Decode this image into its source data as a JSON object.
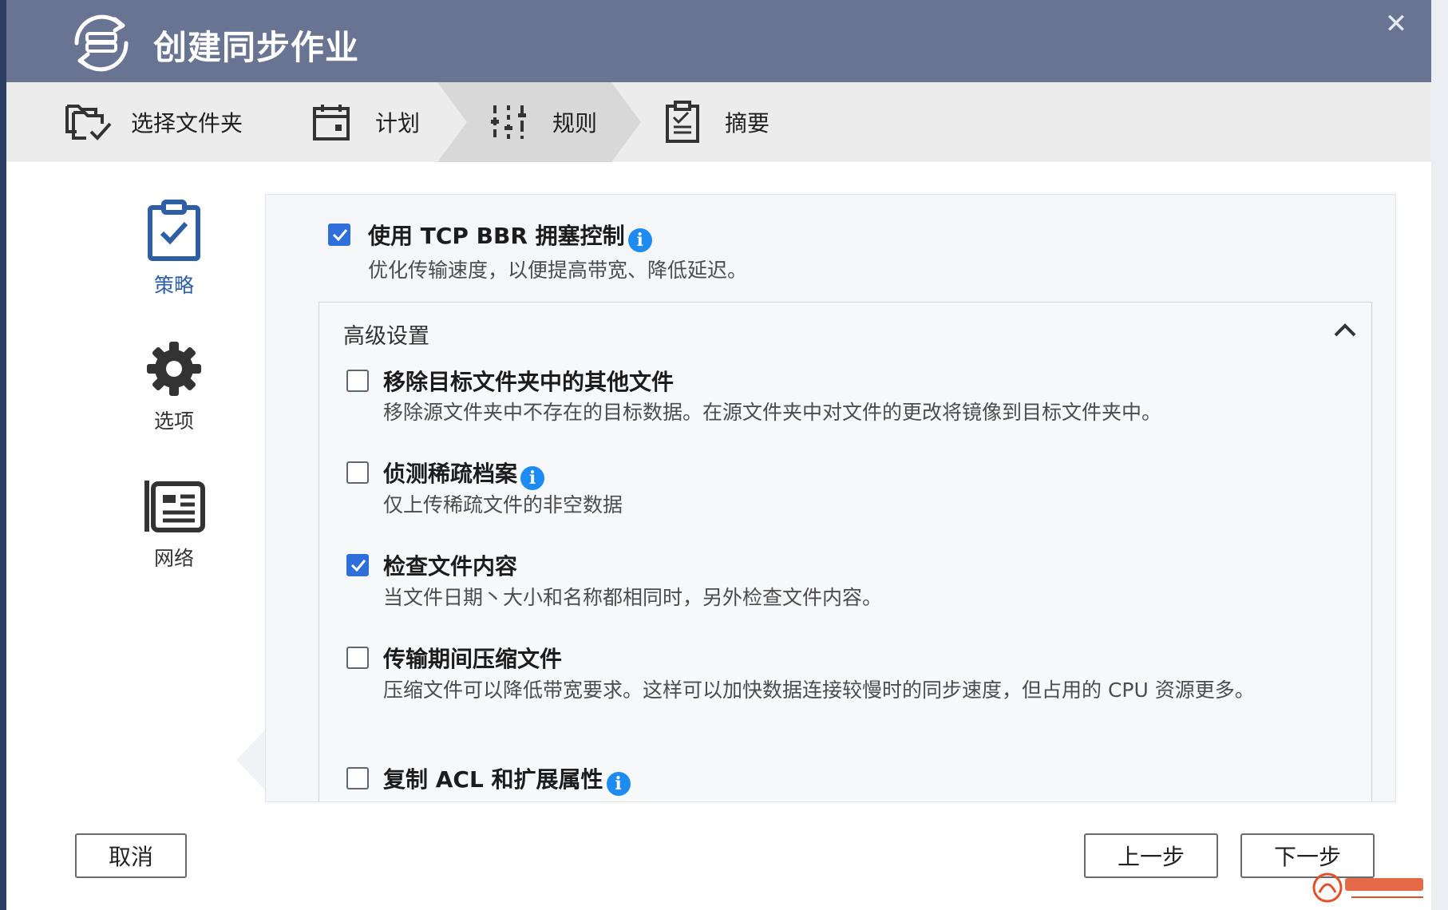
{
  "dialog": {
    "title": "创建同步作业",
    "close_glyph": "✕"
  },
  "steps": [
    {
      "label": "选择文件夹",
      "icon": "folder-sync-icon"
    },
    {
      "label": "计划",
      "icon": "calendar-icon"
    },
    {
      "label": "规则",
      "icon": "sliders-icon",
      "active": true
    },
    {
      "label": "摘要",
      "icon": "clipboard-icon"
    }
  ],
  "sidenav": [
    {
      "label": "策略",
      "icon": "clipboard-check-icon",
      "active": true
    },
    {
      "label": "选项",
      "icon": "gear-icon"
    },
    {
      "label": "网络",
      "icon": "news-icon"
    }
  ],
  "bbr": {
    "title": "使用 TCP BBR 拥塞控制",
    "desc": "优化传输速度，以便提高带宽、降低延迟。",
    "checked": true,
    "has_info": true
  },
  "advanced": {
    "title": "高级设置",
    "expanded": true,
    "options": [
      {
        "title": "移除目标文件夹中的其他文件",
        "desc": "移除源文件夹中不存在的目标数据。在源文件夹中对文件的更改将镜像到目标文件夹中。",
        "checked": false,
        "has_info": false
      },
      {
        "title": "侦测稀疏档案",
        "desc": "仅上传稀疏文件的非空数据",
        "checked": false,
        "has_info": true
      },
      {
        "title": "检查文件内容",
        "desc": "当文件日期丶大小和名称都相同时，另外检查文件内容。",
        "checked": true,
        "has_info": false
      },
      {
        "title": "传输期间压缩文件",
        "desc": "压缩文件可以降低带宽要求。这样可以加快数据连接较慢时的同步速度，但占用的 CPU 资源更多。",
        "checked": false,
        "has_info": false
      },
      {
        "title": "复制 ACL 和扩展属性",
        "desc": "",
        "checked": false,
        "has_info": true
      }
    ]
  },
  "footer": {
    "cancel": "取消",
    "prev": "上一步",
    "next": "下一步"
  },
  "info_glyph": "i",
  "colors": {
    "titlebar": "#687491",
    "accent": "#2f6fdc",
    "info": "#1e8bf3",
    "nav_active": "#2d5ea6"
  }
}
